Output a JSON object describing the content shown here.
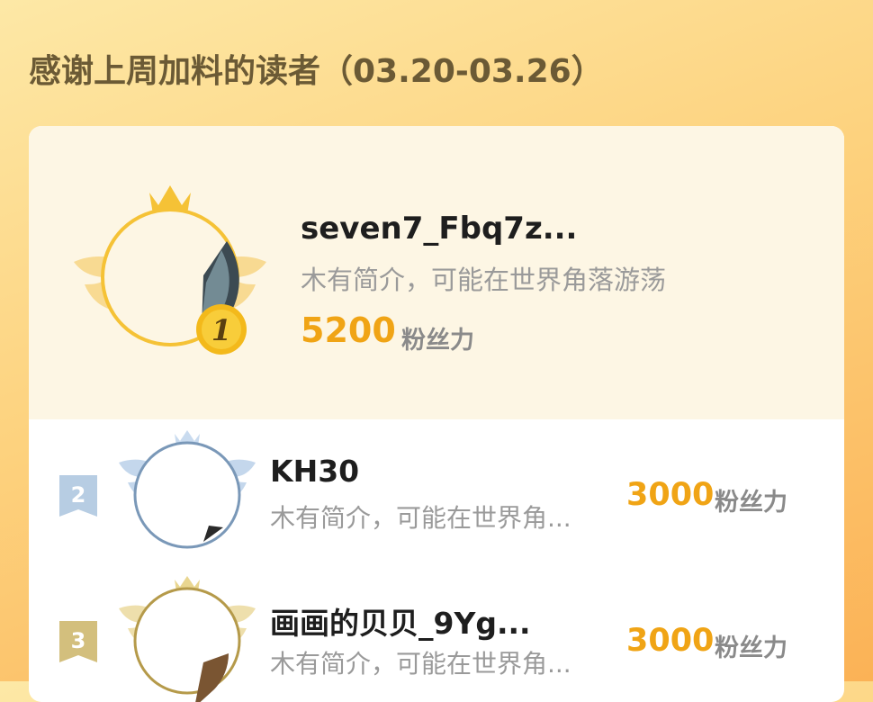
{
  "header": {
    "title": "感谢上周加料的读者（03.20-03.26）"
  },
  "colors": {
    "gold": "#f0a415",
    "silver": "#7a98b8",
    "bronze": "#b59a4a",
    "background": "#fdd27e"
  },
  "leaderboard": {
    "top": {
      "rank": "1",
      "name": "seven7_Fbq7z...",
      "bio": "木有简介，可能在世界角落游荡",
      "score": "5200",
      "unit": "粉丝力"
    },
    "rows": [
      {
        "rank": "2",
        "name": "KH30",
        "bio": "木有简介，可能在世界角...",
        "score": "3000",
        "unit": "粉丝力"
      },
      {
        "rank": "3",
        "name": "画画的贝贝_9Yg...",
        "bio": "木有简介，可能在世界角...",
        "score": "3000",
        "unit": "粉丝力"
      }
    ]
  }
}
